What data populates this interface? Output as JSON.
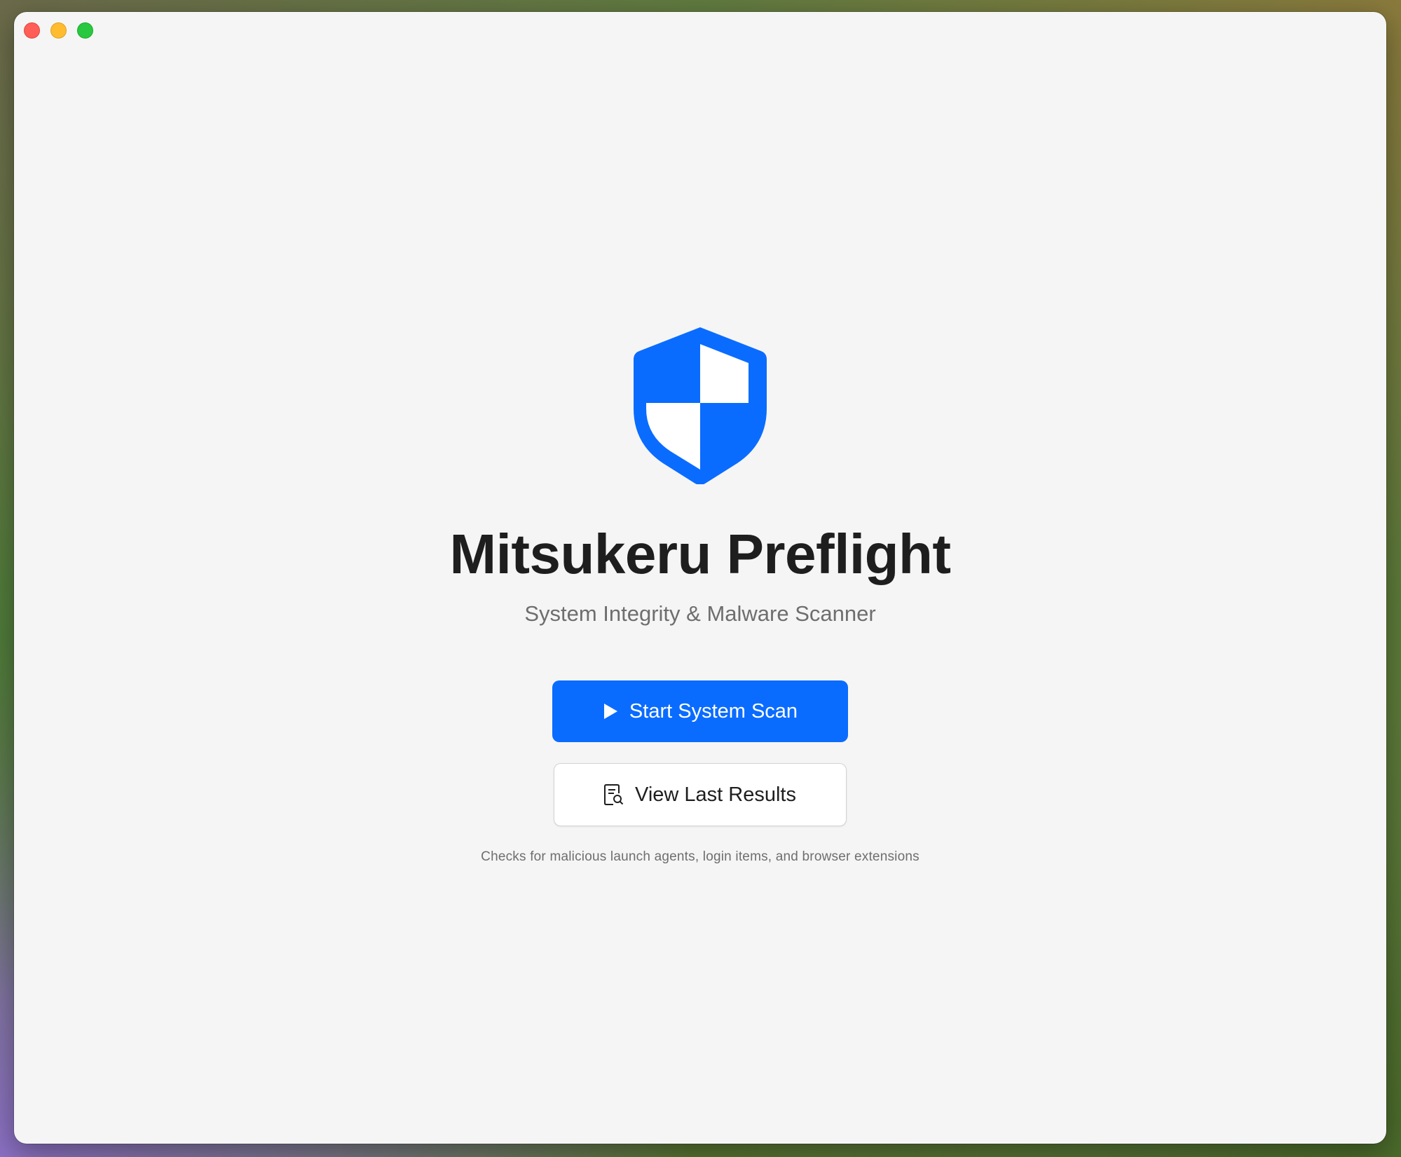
{
  "window": {
    "traffic_lights": [
      "close",
      "minimize",
      "zoom"
    ]
  },
  "hero": {
    "icon": "shield-icon",
    "accent_color": "#0a6cff",
    "title": "Mitsukeru Preflight",
    "subtitle": "System Integrity & Malware Scanner"
  },
  "actions": {
    "primary_label": "Start System Scan",
    "primary_icon": "play-icon",
    "secondary_label": "View Last Results",
    "secondary_icon": "document-search-icon"
  },
  "footnote": "Checks for malicious launch agents, login items, and browser extensions"
}
